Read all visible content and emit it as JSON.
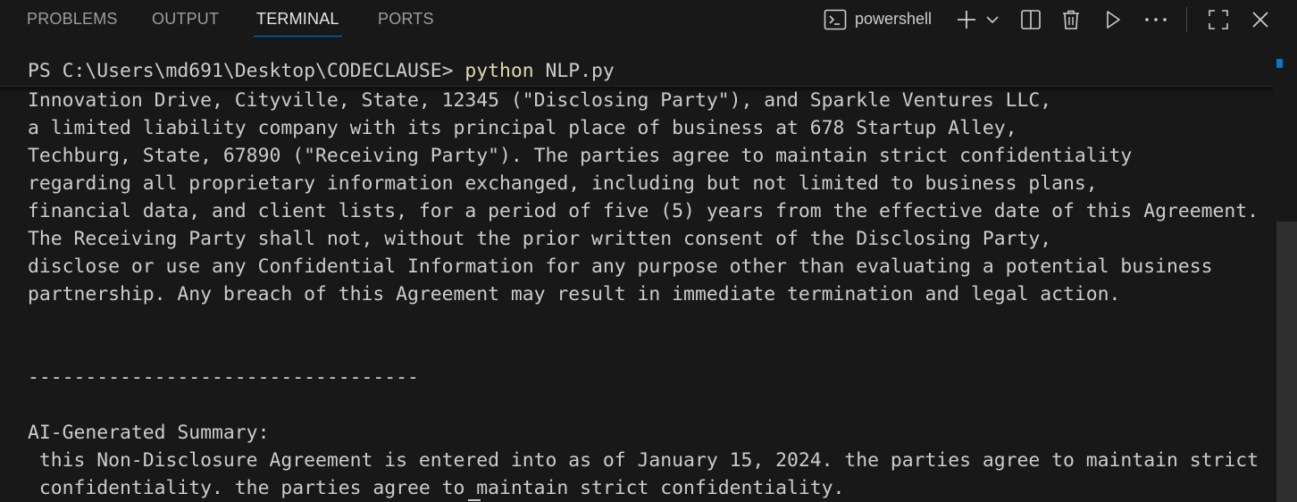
{
  "tabs": [
    {
      "label": "PROBLEMS"
    },
    {
      "label": "OUTPUT"
    },
    {
      "label": "TERMINAL",
      "active": true
    },
    {
      "label": "PORTS"
    }
  ],
  "toolbar": {
    "shell_label": "powershell",
    "icons": [
      "terminal-icon",
      "plus-icon",
      "chevron-down-icon",
      "split-icon",
      "trash-icon",
      "play-icon",
      "more-icon",
      "maximize-icon",
      "close-icon"
    ]
  },
  "terminal": {
    "prompt": "PS C:\\Users\\md691\\Desktop\\CODECLAUSE> ",
    "command": "python",
    "argument": " NLP.py",
    "output_lines": [
      "Innovation Drive, Cityville, State, 12345 (\"Disclosing Party\"), and Sparkle Ventures LLC,",
      "a limited liability company with its principal place of business at 678 Startup Alley,",
      "Techburg, State, 67890 (\"Receiving Party\"). The parties agree to maintain strict confidentiality",
      "regarding all proprietary information exchanged, including but not limited to business plans,",
      "financial data, and client lists, for a period of five (5) years from the effective date of this Agreement.",
      "The Receiving Party shall not, without the prior written consent of the Disclosing Party,",
      "disclose or use any Confidential Information for any purpose other than evaluating a potential business",
      "partnership. Any breach of this Agreement may result in immediate termination and legal action.",
      "",
      "",
      "",
      "----------------------------------",
      "",
      "AI-Generated Summary:",
      " this Non-Disclosure Agreement is entered into as of January 15, 2024. the parties agree to maintain strict",
      " confidentiality. the parties agree to maintain strict confidentiality."
    ]
  },
  "colors": {
    "background": "#181818",
    "text": "#cccccc",
    "command": "#dcdcaa",
    "accent": "#0078d4"
  }
}
